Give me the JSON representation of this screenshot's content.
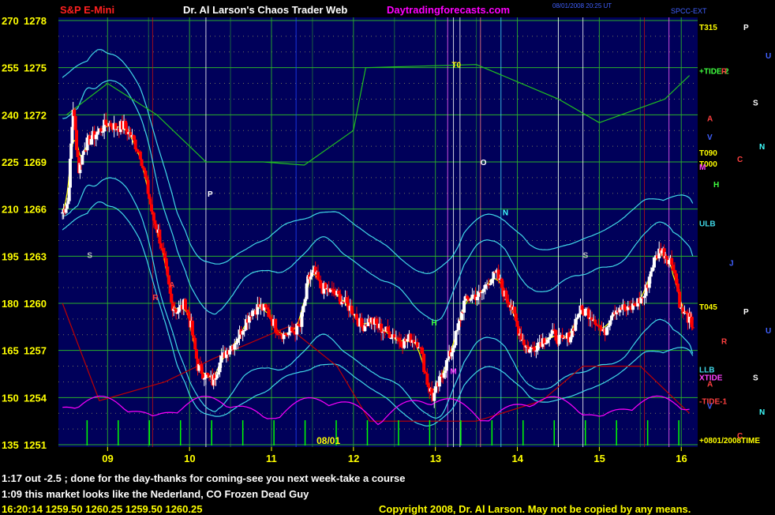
{
  "header": {
    "symbol": "S&P E-Mini",
    "title": "Dr. Al Larson's Chaos Trader Web",
    "site": "Daytradingforecasts.com",
    "stamp": "08/01/2008 20:25 UT",
    "code": "SPCC-EXT"
  },
  "colors": {
    "background": "#00005a",
    "grid_horizontal": "#2ab02a",
    "grid_vertical": "#2ab02a",
    "up_bar": "#ffffff",
    "down_bar": "#ff0000",
    "axis_text": "#ffff00",
    "band": "#40d8e8",
    "ema": "#ffff00",
    "tide": "#20c020",
    "low_line": "#c00000",
    "oscillator": "#ff00ff",
    "spike": "#00ff00",
    "title_symbol": "#ff2020",
    "site": "#ff00ff",
    "copyright": "#ffff00"
  },
  "chart_data": {
    "type": "candlestick",
    "left_axis_labels": [
      {
        "osc": "270",
        "price": "1278"
      },
      {
        "osc": "255",
        "price": "1275"
      },
      {
        "osc": "240",
        "price": "1272"
      },
      {
        "osc": "225",
        "price": "1269"
      },
      {
        "osc": "210",
        "price": "1266"
      },
      {
        "osc": "195",
        "price": "1263"
      },
      {
        "osc": "180",
        "price": "1260"
      },
      {
        "osc": "165",
        "price": "1257"
      },
      {
        "osc": "150",
        "price": "1254"
      },
      {
        "osc": "135",
        "price": "1251"
      }
    ],
    "ylim": [
      1251,
      1278
    ],
    "xlim": [
      8.4,
      16.2
    ],
    "hours": [
      "09",
      "10",
      "11",
      "12",
      "13",
      "14",
      "15",
      "16"
    ],
    "hour_values": [
      9,
      10,
      11,
      12,
      13,
      14,
      15,
      16
    ],
    "date_label": "08/01",
    "close_path": [
      [
        8.45,
        1265.8
      ],
      [
        8.52,
        1266.5
      ],
      [
        8.58,
        1272.5
      ],
      [
        8.65,
        1268.5
      ],
      [
        8.72,
        1270.0
      ],
      [
        8.8,
        1270.5
      ],
      [
        8.9,
        1271.0
      ],
      [
        9.0,
        1271.5
      ],
      [
        9.1,
        1271.2
      ],
      [
        9.2,
        1271.3
      ],
      [
        9.3,
        1270.5
      ],
      [
        9.4,
        1269.5
      ],
      [
        9.48,
        1267.5
      ],
      [
        9.55,
        1265.5
      ],
      [
        9.62,
        1264.5
      ],
      [
        9.7,
        1262.5
      ],
      [
        9.78,
        1260.0
      ],
      [
        9.85,
        1259.5
      ],
      [
        9.95,
        1260.0
      ],
      [
        10.02,
        1258.5
      ],
      [
        10.1,
        1256.0
      ],
      [
        10.18,
        1255.5
      ],
      [
        10.28,
        1255.0
      ],
      [
        10.35,
        1256.0
      ],
      [
        10.45,
        1257.0
      ],
      [
        10.55,
        1257.5
      ],
      [
        10.65,
        1258.5
      ],
      [
        10.75,
        1259.5
      ],
      [
        10.85,
        1259.8
      ],
      [
        10.95,
        1259.5
      ],
      [
        11.05,
        1258.5
      ],
      [
        11.15,
        1258.0
      ],
      [
        11.25,
        1258.2
      ],
      [
        11.35,
        1258.5
      ],
      [
        11.45,
        1261.5
      ],
      [
        11.52,
        1262.0
      ],
      [
        11.6,
        1261.0
      ],
      [
        11.7,
        1260.8
      ],
      [
        11.8,
        1260.5
      ],
      [
        11.9,
        1260.0
      ],
      [
        12.0,
        1259.5
      ],
      [
        12.1,
        1258.5
      ],
      [
        12.2,
        1259.0
      ],
      [
        12.3,
        1258.5
      ],
      [
        12.4,
        1258.2
      ],
      [
        12.5,
        1258.0
      ],
      [
        12.6,
        1257.5
      ],
      [
        12.7,
        1257.8
      ],
      [
        12.8,
        1257.5
      ],
      [
        12.9,
        1255.0
      ],
      [
        12.97,
        1254.0
      ],
      [
        13.05,
        1255.0
      ],
      [
        13.12,
        1256.0
      ],
      [
        13.2,
        1257.0
      ],
      [
        13.28,
        1258.5
      ],
      [
        13.35,
        1260.0
      ],
      [
        13.45,
        1260.5
      ],
      [
        13.55,
        1260.5
      ],
      [
        13.65,
        1261.5
      ],
      [
        13.75,
        1261.8
      ],
      [
        13.85,
        1260.5
      ],
      [
        13.92,
        1260.0
      ],
      [
        14.0,
        1258.5
      ],
      [
        14.08,
        1257.5
      ],
      [
        14.15,
        1257.0
      ],
      [
        14.25,
        1257.5
      ],
      [
        14.35,
        1257.8
      ],
      [
        14.45,
        1258.0
      ],
      [
        14.55,
        1257.5
      ],
      [
        14.65,
        1258.0
      ],
      [
        14.75,
        1259.5
      ],
      [
        14.85,
        1259.5
      ],
      [
        14.95,
        1259.0
      ],
      [
        15.05,
        1258.0
      ],
      [
        15.15,
        1259.5
      ],
      [
        15.25,
        1259.8
      ],
      [
        15.35,
        1259.5
      ],
      [
        15.45,
        1260.0
      ],
      [
        15.55,
        1260.5
      ],
      [
        15.65,
        1262.5
      ],
      [
        15.75,
        1263.5
      ],
      [
        15.82,
        1263.0
      ],
      [
        15.9,
        1262.5
      ],
      [
        16.0,
        1259.5
      ],
      [
        16.1,
        1259.0
      ],
      [
        16.15,
        1258.5
      ]
    ],
    "annotations_right": [
      "T315",
      "+TIDE-2",
      "T090",
      "T000",
      "ULB",
      "T045",
      "LLB",
      "XTIDE",
      "-TIDE-1",
      "+0801/2008TIME"
    ],
    "annotations_left": [
      "P",
      "R",
      "S",
      "H",
      "N",
      "V",
      "A",
      "C",
      "M",
      "J",
      "U",
      "T0",
      "O"
    ],
    "price_scale_strip": [
      "P",
      "U",
      "R",
      "S",
      "A",
      "N",
      "V",
      "C",
      "M",
      "H",
      "A",
      "ULB",
      "J",
      "P",
      "U",
      "R",
      "S",
      "A",
      "N",
      "V",
      "C"
    ]
  },
  "messages": [
    "1:17 out -2.5 ; done for the day-thanks for coming-see you next week-take a course",
    "1:09 this market looks like the Nederland, CO Frozen Dead Guy",
    "16:20:14   1259.50  1260.25  1259.50  1260.25"
  ],
  "copyright": "Copyright 2008, Dr. Al Larson. May not be copied by any means."
}
